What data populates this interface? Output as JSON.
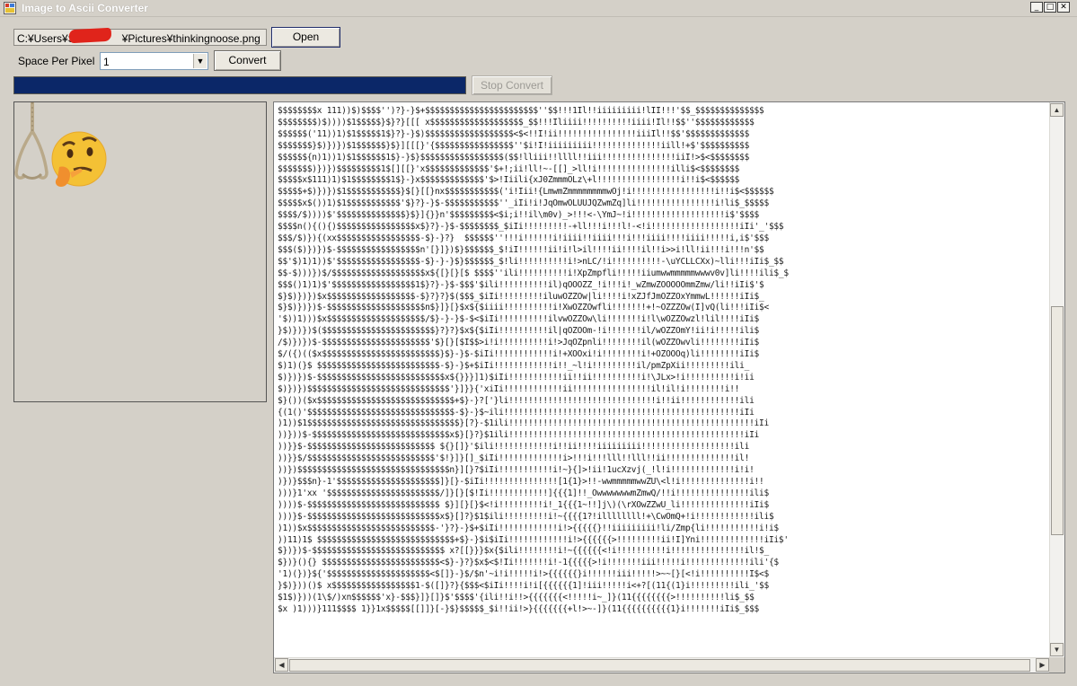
{
  "window": {
    "title": "Image to Ascii Converter",
    "controls": {
      "minimize": "_",
      "maximize": "□",
      "close": "✕"
    }
  },
  "file": {
    "path_prefix": "C:¥Users¥S",
    "path_suffix": "¥Pictures¥thinkingnoose.png",
    "open_label": "Open"
  },
  "settings": {
    "space_per_pixel_label": "Space Per Pixel",
    "space_per_pixel_value": "1",
    "convert_label": "Convert"
  },
  "progress": {
    "value": 1.0,
    "color": "#0b2768"
  },
  "stop_label": "Stop Convert",
  "ascii_lines": [
    "$$$$$$$$x 111))$)$$$$'')?}-}$+$$$$$$$$$$$$$$$$$$$$$$$''$$!!!1Il!!iiiiiiiii!lII!!!'$$_$$$$$$$$$$$$$$",
    "$$$$$$$$)$))))$1$$$$$}$}?}[[[ x$$$$$$$$$$$$$$$$$$$_$$!!!Iliiii!!!!!!!!!!iiii!Il!!$$''$$$$$$$$$$$$",
    "$$$$$$('11))1)$1$$$$$1$}?}-}$)$$$$$$$$$$$$$$$$$$<$<!!I!ii!!!!!!!!!!!!!!!!iiiIl!!$$'$$$$$$$$$$$$$",
    "$$$$$$$}$)})})$1$$$$$$}$}][[[}'{$$$$$$$$$$$$$$$$''$i!I!iiiiiiiii!!!!!!!!!!!!!!iill!+$'$$$$$$$$$$",
    "$$$$$${n)1))1)$1$$$$$$1$}-}$}$$$$$$$$$$$$$$$$$($$!lliii!!llll!!iii!!!!!!!!!!!!!!!iiI!>$<$$$$$$$$",
    "$$$$$$$)})})$$$$$$$$$1$[][[}'x$$$$$$$$$$$$$'$+!;ii!ll!~-[[]_>ll!i!!!!!!!!!!!!!!!illi$<$$$$$$$$",
    "$$$$$x$111)1)$1$$$$$$$$1$}-}x$$$$$$$$$$$$$'$>!Iiili{xJ0ZmmmOLz\\+l!!!!!!!!!!!!!!!!!i!!i$<$$$$$$",
    "$$$$$+$)})})$1$$$$$$$$$$$}$[}[[}nx$$$$$$$$$$$('i!Iii!{LmwmZmmmmmmmmwOj!i!!!!!!!!!!!!!!!!!i!!i$<$$$$$$",
    "$$$$$x$())1)$1$$$$$$$$$$$'$}?}-}$-$$$$$$$$$$$''_iIi!i!JqOmwOLUUJQZwmZq]li!!!!!!!!!!!!!!!!i!li$_$$$$$",
    "$$$$/$))))$'$$$$$$$$$$$$$$}$}]{}}n'$$$$$$$$$<$i;i!!il\\m0v)_>!!!<-\\YmJ~!i!!!!!!!!!!!!!!!!!!!i$'$$$$",
    "$$$$n(){(){)$$$$$$$$$$$$$$$$x$}?}-}$-$$$$$$$$_$iIi!!!!!!!!!-+ll!!!i!!!l!-<!i!!!!!!!!!!!!!!!!!!iIi'_'$$$",
    "$$$/$)}){(xx$$$$$$$$$$$$$$$$$-$}-}?}  $$$$$$''!!!i!!!!!!i!iiii!!iiii!!!i!!!iiii!!!!iiii!!!!!i,i$'$$$",
    "$$$($)})})$-$$$$$$$$$$$$$$$$$n'[}]})$}$$$$$$_$!iI!!!!!!ii!i!l>il!!!!ii!!!!il!!i>>i!ll!ii!!!i!!!n'$$",
    "$$'$)1)1))$'$$$$$$$$$$$$$$$$$-$}-}-}$}$$$$$$_$!li!!!!!!!!!!i!>nLC/!i!!!!!!!!!!-\\uYCLLCXx)~lli!!!iIi$_$$",
    "$$-$)))})$/$$$$$$$$$$$$$$$$$$$x${[}[}[$ $$$$''ili!!!!!!!!!!i!XpZmpfli!!!!!iiumwwmmmmmwwwv0v]li!!!!ili$_$",
    "$$$()1)1)$'$$$$$$$$$$$$$$$$$1$}?}-}$-$$$'$ili!!!!!!!!!!il)qOOOZZ_!i!!!i!_wZmwZOOOOOmmZmw/li!!iIi$'$",
    "$}$)})})$x$$$$$$$$$$$$$$$$$$-$}?}?}$($$$_$iIi!!!!!!!!!iluwOZZOw|li!!!!i!xZJfJmOZZOxYmmwL!!!!!!iIi$_",
    "$}$)})})$-$$$$$$$$$$$$$$$$$$$$n$}]}[}$x${$iiii!!!!!!!!!!i!XwOZZOwfli!!!!!!!+!~OZZZOw(I]vQ(li!!!iIi$<",
    "'$))1)))$x$$$$$$$$$$$$$$$$$$$$/$}-}-}$-$<$iIi!!!!!!!!!!ilvwOZZOw\\li!!!!!!!i!l\\wOZZOwzl!lil!!!!iIi$",
    "}$)})})$($$$$$$$$$$$$$$$$$$$$$$$}?}?}$x${$iIi!!!!!!!!!!il|qOZOOm-!i!!!!!!!il/wOZZOmY!ii!i!!!!!ili$",
    "/$)})})$-$$$$$$$$$$$$$$$$$$$$$$'$}[}[$I$$>i!i!!!!!!!!!!i!>JqOZpnli!!!!!!!!il(wOZZOwvli!!!!!!!!iIi$",
    "$/({)(($x$$$$$$$$$$$$$$$$$$$$$$$$}$}-}$-$iIi!!!!!!!!!!!!i!+XOOxi!i!!!!!!!!i!+OZOOOq)li!!!!!!!!iIi$",
    "$)1)(}$ $$$$$$$$$$$$$$$$$$$$$$$$$-$}-}$+$iIi!!!!!!!!!!!!i!!_~l!i!!!!!!!!!il/pmZpXii!!!!!!!!!ili_",
    "$)})})$-$$$$$$$$$$$$$$$$$$$$$$$$$$x${}}}]1)$iIi!!!!!!!!!!!ii!!ii!!!!!!!!!!i!\\JLx>!i!!!!!!!!!!i!ii",
    "$)})})$$$$$$$$$$$$$$$$$$$$$$$$$$$$$'}]}}{'xiIi!!!!!!!!!!!!ii!!!!!!!!!!!!!!!!il!il!i!!!!!!!!i!!",
    "$}())($x$$$$$$$$$$$$$$$$$$$$$$$$$$$$+$}-}?['}li!!!!!!!!!!!!!!!!!!!!!!!!!!!!!!i!!ii!!!!!!!!!!!!ili",
    "{(1()'$$$$$$$$$$$$$$$$$$$$$$$$$$$$$$-$}-}$~ili!!!!!!!!!!!!!!!!!!!!!!!!!!!!!!!!!!!!!!!!!!!!!!!!iIi",
    ")1))$1$$$$$$$$$$$$$$$$$$$$$$$$$$$$$$$}[?}-$1ili!!!!!!!!!!!!!!!!!!!!!!!!!!!!!!!!!!!!!!!!!!!!!!!!!!iIi",
    "))}))$-$$$$$$$$$$$$$$$$$$$$$$$$$$$$x$}[}?}$1ili!!!!!!!!!!!!!!!!!!!!!!!!!!!!!!!!!!!!!!!!!!!!!!!!iIi",
    "))}}$-$$$$$$$$$$$$$$$$$$$$$$$$$$ ${}[]}'$ili!!!!!!!!!!!!i!!ii!!!!iiiiiiiii!!!!!!!!!!!!!!!!!!!ili",
    "))}}$/$$$$$$$$$$$$$$$$$$$$$$$$$$'$!}]}[]_$iIi!!!!!!!!!!!!!i>!!!i!!!lll!!lll!!ii!!!!!!!!!!!!!!il!",
    "))})$$$$$$$$$$$$$$$$$$$$$$$$$$$$$$$n}][}?$iIi!!!!!!!!!!!i!~}{]>!ii!1ucXzvj(_!l!i!!!!!!!!!!!!!i!i!",
    ")})}$$$n}-1'$$$$$$$$$$$$$$$$$$$$$]}[}-$iIi!!!!!!!!!!!!!!![1{1}>!!-wwmmmmmwwZU\\<l!i!!!!!!!!!!!!!!i!!",
    ")))}1'xx '$$$$$$$$$$$$$$$$$$$$$$$/]}[}[$!Ii!!!!!!!!!!!!]{{{1]!!_OwwwwwwwmZmwQ/!!i!!!!!!!!!!!!!!!ili$",
    "))))$-$$$$$$$$$$$$$$$$$$$$$$$$$$$ $}][}[}$<!i!!!!!!!!!i!_1{{{1~!!]j\\)(\\rXOwZZwU_li!!!!!!!!!!!!!!iIi$",
    ")))}$-$$$$$$$$$$$$$$$$$$$$$$$$$$$x$}[]?}$1$ili!!!!!!!!!i!~{{{{1?!illllllll!+\\CwOmQ+!i!!!!!!!!!!!!ili$",
    ")1))$x$$$$$$$$$$$$$$$$$$$$$$$$$$-'}?}-}$+$iIi!!!!!!!!!!!!i!>{{{{{}!!iiiiiiiii!li/Zmp{li!!!!!!!!!!!i!i$",
    "))11)1$ $$$$$$$$$$$$$$$$$$$$$$$$$$$$+$}-}$i$iIi!!!!!!!!!!!!i!>{{{{{{>!!!!!!!!!ii!I]Yni!!!!!!!!!!!!!iIi$'",
    "$})})$-$$$$$$$$$$$$$$$$$$$$$$$$$$$ x?[[}}}$x{$ili!!!!!!!!i!~{{{{{{<!i!!!!!!!!!!i!!!!!!!!!!!!!!!il!$_",
    "$})}(){} $$$$$$$$$$$$$$$$$$$$$$$$<$}-}?}$x$<$!Ii!!!!!!!i!-1{{{{{>!i!!!!!!!iii!!!!!i!!!!!!!!!!!!!ili'{$",
    "'1)(})}${'$$$$$$$$$$$$$$$$$$$$$<$[]}-}$/$n'~i!i!!!!!i!>{{{{{{}i!!!!!!iii!!!!!>~~[}[<!i!!!!!!!!!!I$<$",
    "}$)}))()$ x$$$$$$$$$$$$$$$$$1-$([]}?}{$$$<$iIi!!!!i!i[{{{{{{1]!iii!!!!!i<+?[(11{(1}i!!!!!!!!!ili_'$$",
    "$1$)}))(1\\$/)xn$$$$$$'x}-$$$}]}[]}$'$$$$'{ili!!i!!>{{{{{{{<!!!!!i~_]}(11{{{{{{{{>!!!!!!!!!!li$_$$",
    "$x )1)))}111$$$$ 1}}1x$$$$$[[]]}[-}$}$$$$$_$i!!ii!>}{{{{{{{+l!>~-]}(11{{{{{{{{{{1}i!!!!!!!iIi$_$$$"
  ]
}
